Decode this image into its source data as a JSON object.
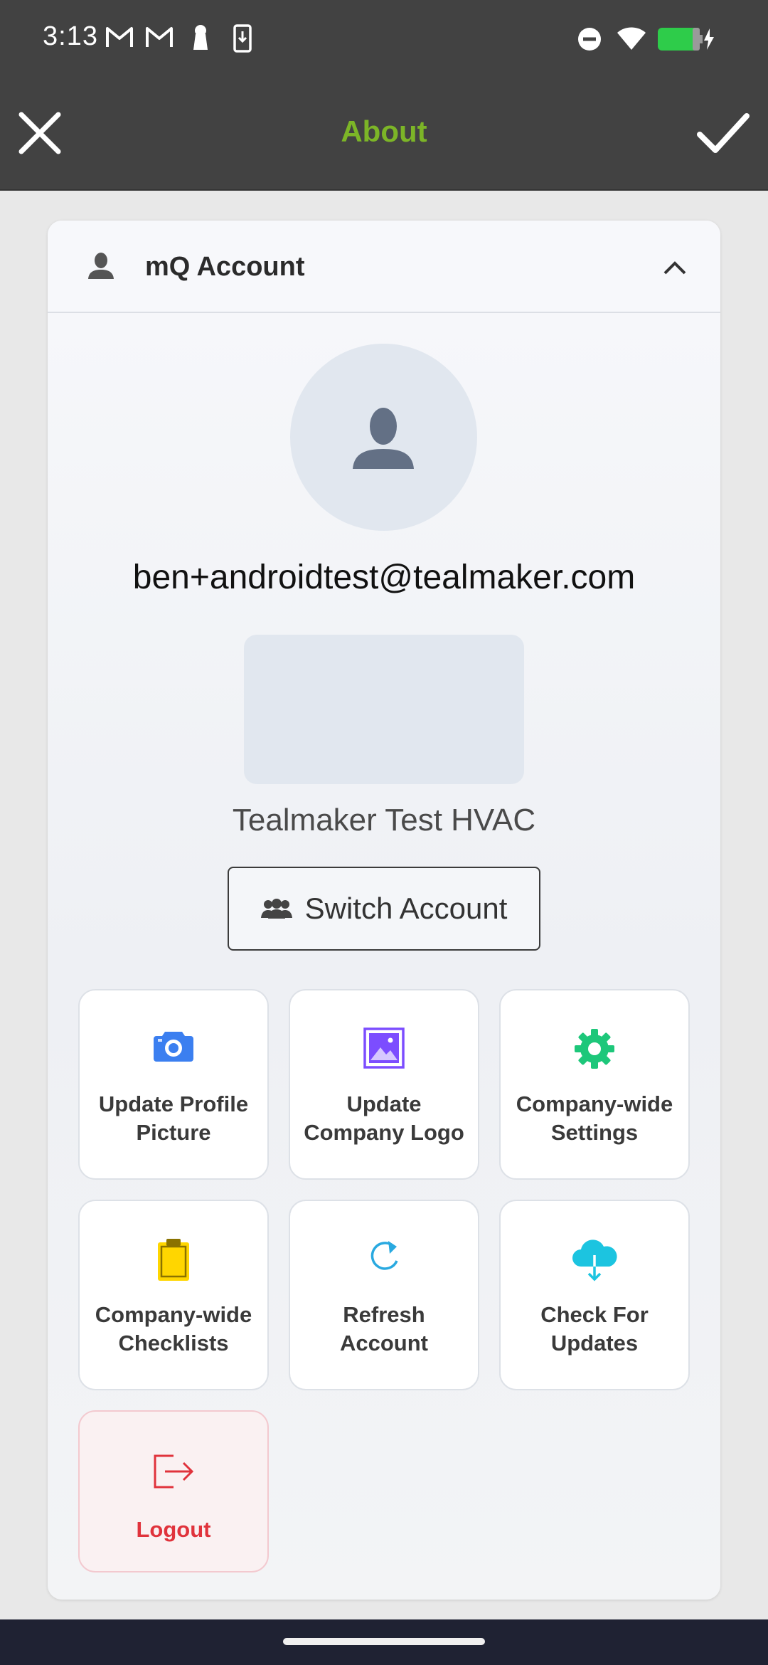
{
  "status_bar": {
    "time": "3:13",
    "icons": [
      "gmail-icon",
      "gmail-icon",
      "keyhole-icon",
      "phone-download-icon",
      "do-not-disturb-icon",
      "wifi-icon",
      "battery-charging-icon"
    ]
  },
  "app_bar": {
    "title": "About",
    "close_icon": "close-icon",
    "confirm_icon": "check-icon"
  },
  "account_section": {
    "header_title": "mQ Account",
    "expanded": true,
    "email": "ben+androidtest@tealmaker.com",
    "company_name": "Tealmaker Test HVAC",
    "switch_account_label": "Switch Account"
  },
  "actions": [
    {
      "label_line1": "Update Profile",
      "label_line2": "Picture",
      "icon": "camera-icon",
      "color": "#3b7ff0"
    },
    {
      "label_line1": "Update",
      "label_line2": "Company Logo",
      "icon": "image-icon",
      "color": "#7c4dff"
    },
    {
      "label_line1": "Company-wide",
      "label_line2": "Settings",
      "icon": "gear-icon",
      "color": "#1dc77a"
    },
    {
      "label_line1": "Company-wide",
      "label_line2": "Checklists",
      "icon": "clipboard-icon",
      "color": "#ffd600"
    },
    {
      "label_line1": "Refresh",
      "label_line2": "Account",
      "icon": "refresh-icon",
      "color": "#29a9e0"
    },
    {
      "label_line1": "Check For",
      "label_line2": "Updates",
      "icon": "cloud-download-icon",
      "color": "#1cc4e0"
    },
    {
      "label_line1": "Logout",
      "label_line2": "",
      "icon": "logout-icon",
      "color": "#e0333c"
    }
  ],
  "colors": {
    "title_green": "#7cb527",
    "bar_dark": "#424242",
    "logout_red": "#e0333c"
  }
}
